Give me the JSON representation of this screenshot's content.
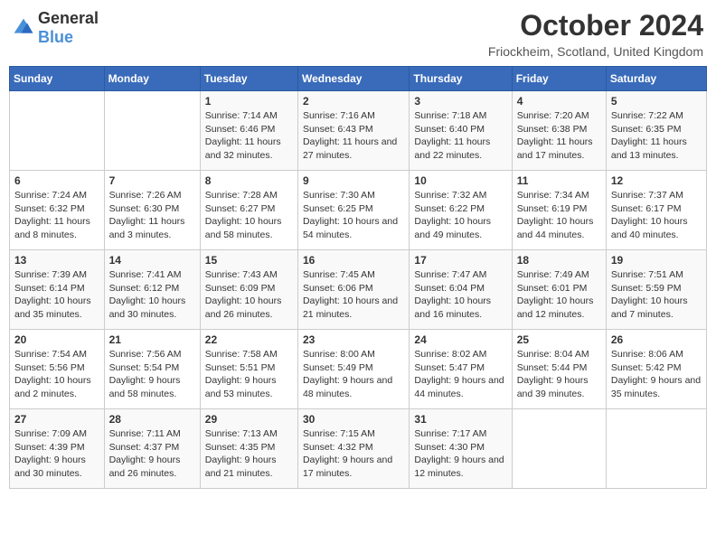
{
  "header": {
    "logo_general": "General",
    "logo_blue": "Blue",
    "month_title": "October 2024",
    "subtitle": "Friockheim, Scotland, United Kingdom"
  },
  "weekdays": [
    "Sunday",
    "Monday",
    "Tuesday",
    "Wednesday",
    "Thursday",
    "Friday",
    "Saturday"
  ],
  "weeks": [
    [
      {
        "day": "",
        "info": ""
      },
      {
        "day": "",
        "info": ""
      },
      {
        "day": "1",
        "info": "Sunrise: 7:14 AM\nSunset: 6:46 PM\nDaylight: 11 hours and 32 minutes."
      },
      {
        "day": "2",
        "info": "Sunrise: 7:16 AM\nSunset: 6:43 PM\nDaylight: 11 hours and 27 minutes."
      },
      {
        "day": "3",
        "info": "Sunrise: 7:18 AM\nSunset: 6:40 PM\nDaylight: 11 hours and 22 minutes."
      },
      {
        "day": "4",
        "info": "Sunrise: 7:20 AM\nSunset: 6:38 PM\nDaylight: 11 hours and 17 minutes."
      },
      {
        "day": "5",
        "info": "Sunrise: 7:22 AM\nSunset: 6:35 PM\nDaylight: 11 hours and 13 minutes."
      }
    ],
    [
      {
        "day": "6",
        "info": "Sunrise: 7:24 AM\nSunset: 6:32 PM\nDaylight: 11 hours and 8 minutes."
      },
      {
        "day": "7",
        "info": "Sunrise: 7:26 AM\nSunset: 6:30 PM\nDaylight: 11 hours and 3 minutes."
      },
      {
        "day": "8",
        "info": "Sunrise: 7:28 AM\nSunset: 6:27 PM\nDaylight: 10 hours and 58 minutes."
      },
      {
        "day": "9",
        "info": "Sunrise: 7:30 AM\nSunset: 6:25 PM\nDaylight: 10 hours and 54 minutes."
      },
      {
        "day": "10",
        "info": "Sunrise: 7:32 AM\nSunset: 6:22 PM\nDaylight: 10 hours and 49 minutes."
      },
      {
        "day": "11",
        "info": "Sunrise: 7:34 AM\nSunset: 6:19 PM\nDaylight: 10 hours and 44 minutes."
      },
      {
        "day": "12",
        "info": "Sunrise: 7:37 AM\nSunset: 6:17 PM\nDaylight: 10 hours and 40 minutes."
      }
    ],
    [
      {
        "day": "13",
        "info": "Sunrise: 7:39 AM\nSunset: 6:14 PM\nDaylight: 10 hours and 35 minutes."
      },
      {
        "day": "14",
        "info": "Sunrise: 7:41 AM\nSunset: 6:12 PM\nDaylight: 10 hours and 30 minutes."
      },
      {
        "day": "15",
        "info": "Sunrise: 7:43 AM\nSunset: 6:09 PM\nDaylight: 10 hours and 26 minutes."
      },
      {
        "day": "16",
        "info": "Sunrise: 7:45 AM\nSunset: 6:06 PM\nDaylight: 10 hours and 21 minutes."
      },
      {
        "day": "17",
        "info": "Sunrise: 7:47 AM\nSunset: 6:04 PM\nDaylight: 10 hours and 16 minutes."
      },
      {
        "day": "18",
        "info": "Sunrise: 7:49 AM\nSunset: 6:01 PM\nDaylight: 10 hours and 12 minutes."
      },
      {
        "day": "19",
        "info": "Sunrise: 7:51 AM\nSunset: 5:59 PM\nDaylight: 10 hours and 7 minutes."
      }
    ],
    [
      {
        "day": "20",
        "info": "Sunrise: 7:54 AM\nSunset: 5:56 PM\nDaylight: 10 hours and 2 minutes."
      },
      {
        "day": "21",
        "info": "Sunrise: 7:56 AM\nSunset: 5:54 PM\nDaylight: 9 hours and 58 minutes."
      },
      {
        "day": "22",
        "info": "Sunrise: 7:58 AM\nSunset: 5:51 PM\nDaylight: 9 hours and 53 minutes."
      },
      {
        "day": "23",
        "info": "Sunrise: 8:00 AM\nSunset: 5:49 PM\nDaylight: 9 hours and 48 minutes."
      },
      {
        "day": "24",
        "info": "Sunrise: 8:02 AM\nSunset: 5:47 PM\nDaylight: 9 hours and 44 minutes."
      },
      {
        "day": "25",
        "info": "Sunrise: 8:04 AM\nSunset: 5:44 PM\nDaylight: 9 hours and 39 minutes."
      },
      {
        "day": "26",
        "info": "Sunrise: 8:06 AM\nSunset: 5:42 PM\nDaylight: 9 hours and 35 minutes."
      }
    ],
    [
      {
        "day": "27",
        "info": "Sunrise: 7:09 AM\nSunset: 4:39 PM\nDaylight: 9 hours and 30 minutes."
      },
      {
        "day": "28",
        "info": "Sunrise: 7:11 AM\nSunset: 4:37 PM\nDaylight: 9 hours and 26 minutes."
      },
      {
        "day": "29",
        "info": "Sunrise: 7:13 AM\nSunset: 4:35 PM\nDaylight: 9 hours and 21 minutes."
      },
      {
        "day": "30",
        "info": "Sunrise: 7:15 AM\nSunset: 4:32 PM\nDaylight: 9 hours and 17 minutes."
      },
      {
        "day": "31",
        "info": "Sunrise: 7:17 AM\nSunset: 4:30 PM\nDaylight: 9 hours and 12 minutes."
      },
      {
        "day": "",
        "info": ""
      },
      {
        "day": "",
        "info": ""
      }
    ]
  ]
}
